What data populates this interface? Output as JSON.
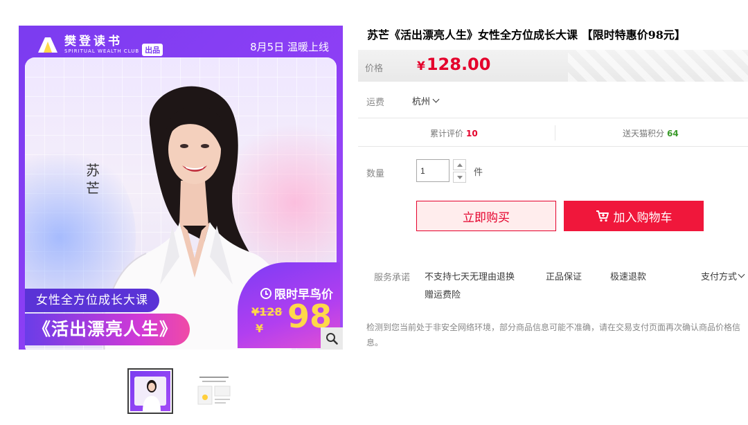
{
  "image": {
    "brand_name": "樊登读书",
    "brand_sub": "SPIRITUAL WEALTH CLUB",
    "brand_tag": "出品",
    "launch_text": "8月5日 温暖上线",
    "person_name": "苏芒",
    "subtitle": "女性全方位成长大课",
    "title": "《活出漂亮人生》",
    "early_bird": "限时早鸟价",
    "original_price": "¥128",
    "sale_yen": "¥",
    "sale_price": "98"
  },
  "product": {
    "title": "苏芒《活出漂亮人生》女性全方位成长大课 【限时特惠价98元】",
    "price_label": "价格",
    "price_currency": "¥",
    "price_value": "128.00",
    "shipping_label": "运费",
    "shipping_city": "杭州",
    "reviews_label": "累计评价",
    "reviews_count": "10",
    "points_label": "送天猫积分",
    "points_count": "64",
    "qty_label": "数量",
    "qty_value": "1",
    "qty_unit": "件",
    "buy_now": "立即购买",
    "add_cart": "加入购物车",
    "service_label": "服务承诺",
    "services": [
      "不支持七天无理由退换",
      "正品保证",
      "极速退款",
      "赠运费险"
    ],
    "pay_method": "支付方式",
    "notice": "检测到您当前处于非安全网络环境，部分商品信息可能不准确，请在交易支付页面再次确认商品价格信息。"
  },
  "colors": {
    "accent_red": "#e4002b",
    "cart_red": "#f0173b",
    "brand_purple": "#7b3cf0",
    "points_green": "#3a9a2a"
  }
}
